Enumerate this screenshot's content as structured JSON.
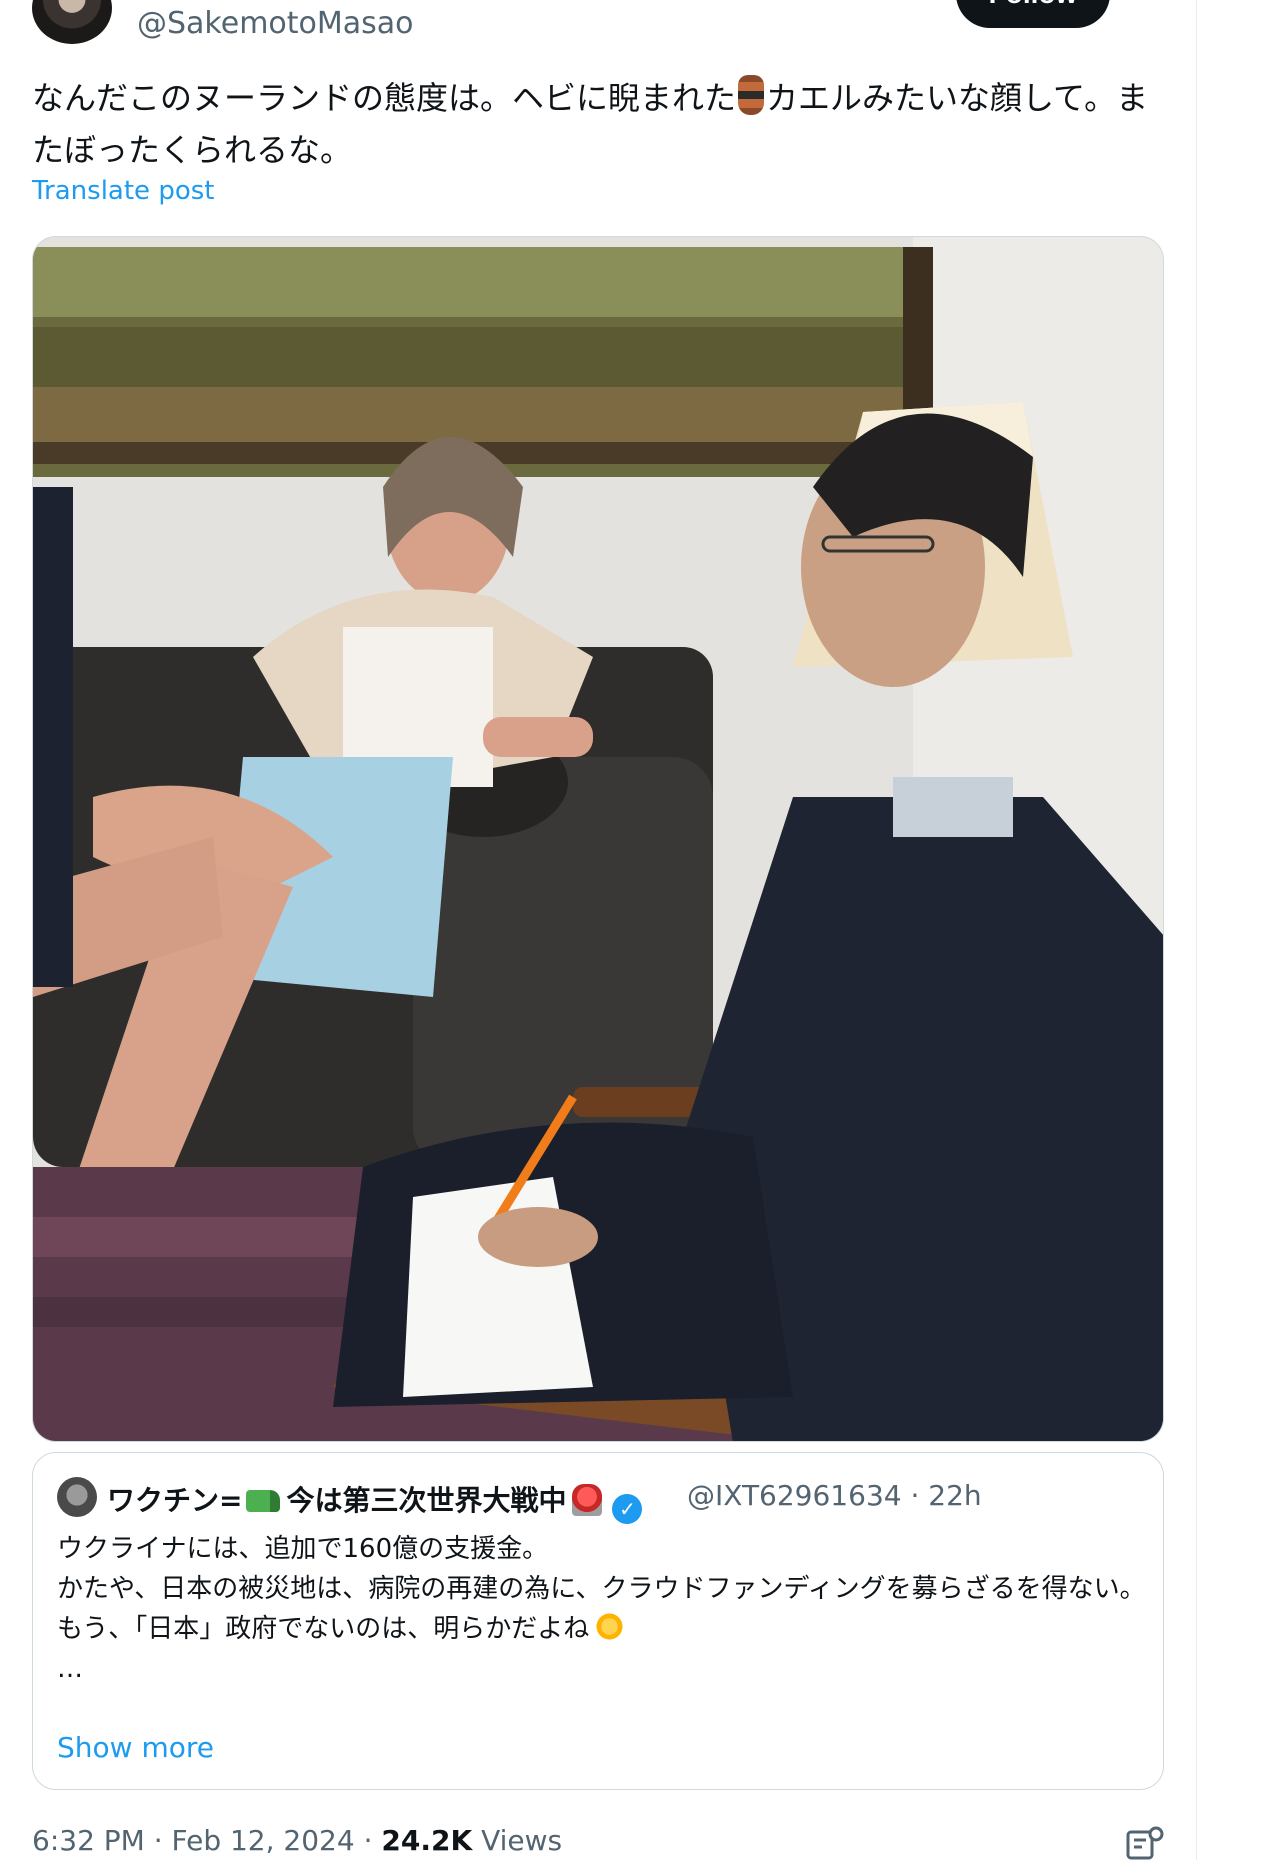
{
  "author": {
    "handle": "@SakemotoMasao",
    "follow_label": "Follow"
  },
  "post": {
    "text_part1": "なんだこのヌーランドの態度は。ヘビに睨まれた",
    "emoji_name": "amphora-emoji",
    "text_part2": "カエルみたいな顔して。またぼったくられるな。",
    "translate_label": "Translate post"
  },
  "media": {
    "icon": "photo-image"
  },
  "quoted": {
    "name_part1": "ワクチン=",
    "name_emoji1": "water-pistol-emoji",
    "name_part2": "今は第三次世界大戦中",
    "name_emoji2": "police-light-emoji",
    "verified_icon": "verified-badge-icon",
    "handle_time": "@IXT62961634 · 22h",
    "lines": [
      "ウクライナには、追加で160億の支援金。",
      "かたや、日本の被災地は、病院の再建の為に、クラウドファンディングを募らざるを得ない。",
      "もう、「日本」政府でないのは、明らかだよね",
      "…"
    ],
    "line3_emoji": "dizzy-emoji",
    "show_more": "Show more"
  },
  "footer": {
    "time_date": "6:32 PM · Feb 12, 2024 · ",
    "views_count": "24.2K",
    "views_label": " Views",
    "analytics_icon": "analytics-icon"
  },
  "colors": {
    "link": "#1d9bf0",
    "text": "#0f1419",
    "muted": "#536471",
    "border": "#cfd9de"
  }
}
